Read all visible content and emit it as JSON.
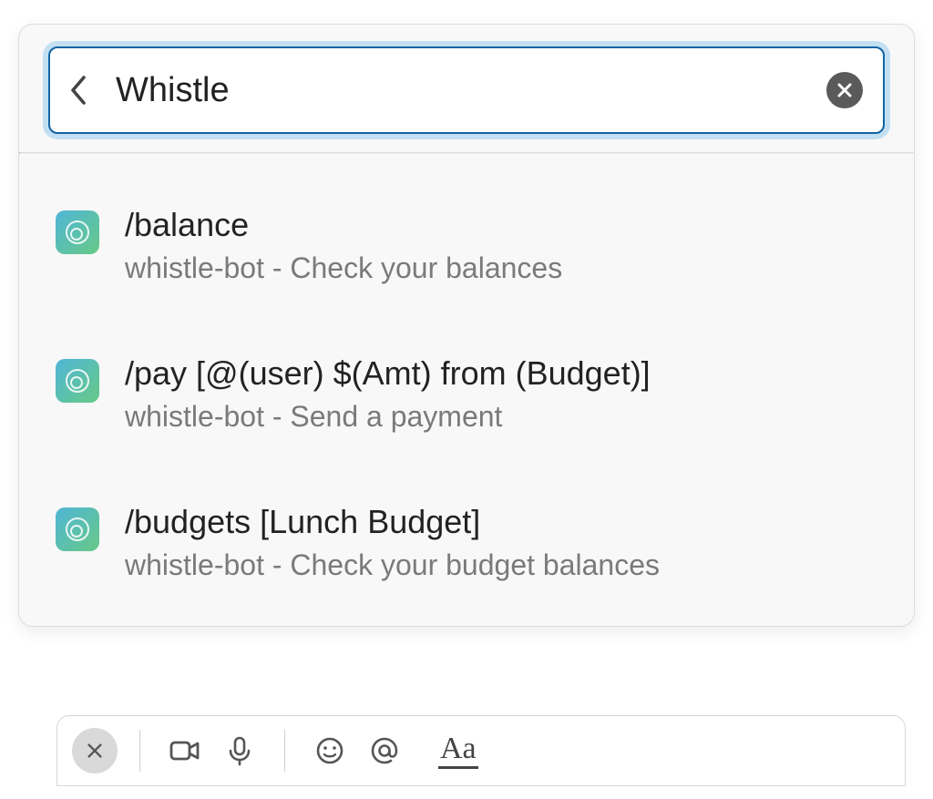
{
  "search": {
    "value": "Whistle"
  },
  "results": [
    {
      "title": "/balance",
      "subtitle": "whistle-bot - Check your balances",
      "app_icon": "whistle-bot-icon"
    },
    {
      "title": "/pay [@(user) $(Amt) from (Budget)]",
      "subtitle": "whistle-bot - Send a payment",
      "app_icon": "whistle-bot-icon"
    },
    {
      "title": "/budgets [Lunch Budget]",
      "subtitle": "whistle-bot - Check your budget balances",
      "app_icon": "whistle-bot-icon"
    }
  ],
  "composer": {
    "format_label": "Aa"
  }
}
